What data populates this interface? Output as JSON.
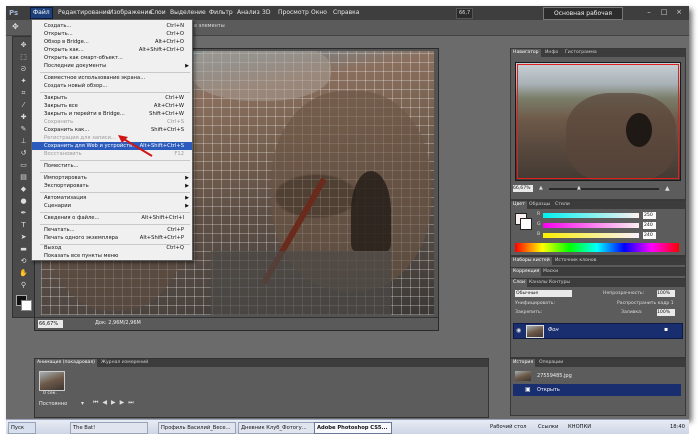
{
  "menubar": {
    "logo": "Ps",
    "items": [
      "Файл",
      "Редактирование",
      "Изображение",
      "Слои",
      "Выделение",
      "Фильтр",
      "Анализ",
      "3D",
      "Просмотр",
      "Окно",
      "Справка"
    ],
    "zoom": "66,7",
    "workspace_button": "Основная рабочая среда"
  },
  "options_bar": {
    "text": "е элементы"
  },
  "file_menu": {
    "items": [
      {
        "label": "Создать...",
        "shortcut": "Ctrl+N"
      },
      {
        "label": "Открыть...",
        "shortcut": "Ctrl+O"
      },
      {
        "label": "Обзор в Bridge...",
        "shortcut": "Alt+Ctrl+O"
      },
      {
        "label": "Открыть как...",
        "shortcut": "Alt+Shift+Ctrl+O"
      },
      {
        "label": "Открыть как смарт-объект...",
        "shortcut": ""
      },
      {
        "label": "Последние документы",
        "shortcut": ""
      },
      {
        "label": "Совместное использование экрана...",
        "shortcut": ""
      },
      {
        "label": "Создать новый обзор...",
        "shortcut": ""
      },
      {
        "label": "Закрыть",
        "shortcut": "Ctrl+W"
      },
      {
        "label": "Закрыть все",
        "shortcut": "Alt+Ctrl+W"
      },
      {
        "label": "Закрыть и перейти в Bridge...",
        "shortcut": "Shift+Ctrl+W"
      },
      {
        "label": "Сохранить",
        "shortcut": "Ctrl+S"
      },
      {
        "label": "Сохранить как...",
        "shortcut": "Shift+Ctrl+S"
      },
      {
        "label": "Регистрация для записи...",
        "shortcut": ""
      },
      {
        "label": "Сохранить для Web и устройств...",
        "shortcut": "Alt+Shift+Ctrl+S"
      },
      {
        "label": "Восстановить",
        "shortcut": "F12"
      },
      {
        "label": "Поместить...",
        "shortcut": ""
      },
      {
        "label": "Импортировать",
        "shortcut": ""
      },
      {
        "label": "Экспортировать",
        "shortcut": ""
      },
      {
        "label": "Автоматизация",
        "shortcut": ""
      },
      {
        "label": "Сценарии",
        "shortcut": ""
      },
      {
        "label": "Сведения о файле...",
        "shortcut": "Alt+Shift+Ctrl+I"
      },
      {
        "label": "Печатать...",
        "shortcut": "Ctrl+P"
      },
      {
        "label": "Печать одного экземпляра",
        "shortcut": "Alt+Shift+Ctrl+P"
      },
      {
        "label": "Выход",
        "shortcut": "Ctrl+Q"
      },
      {
        "label": "Показать все пункты меню",
        "shortcut": ""
      }
    ]
  },
  "document": {
    "zoom": "66,67%",
    "info": "Док: 2,96M/2,96M"
  },
  "navigator": {
    "tabs": [
      "Навигатор",
      "Инфо",
      "Гистограмма"
    ],
    "zoom": "66,67%"
  },
  "color_panel": {
    "tabs": [
      "Цвет",
      "Образцы",
      "Стили"
    ],
    "channels": [
      {
        "label": "R",
        "value": "250"
      },
      {
        "label": "G",
        "value": "240"
      },
      {
        "label": "B",
        "value": "240"
      }
    ]
  },
  "adjust_panel": {
    "tabs": [
      "Наборы кистей",
      "Источник клонов"
    ]
  },
  "correction_panel": {
    "tabs": [
      "Коррекция",
      "Маски"
    ]
  },
  "layers_panel": {
    "tabs": [
      "Слои",
      "Каналы",
      "Контуры"
    ],
    "blend_mode": "Обычные",
    "opacity_label": "Непрозрачность:",
    "opacity_value": "100%",
    "lock_label": "Закрепить:",
    "fill_label": "Заливка:",
    "fill_value": "100%",
    "propagate_label": "Распространить кадр 1",
    "unify_label": "Унифицировать:",
    "layer_name": "Фон"
  },
  "history_panel": {
    "tabs": [
      "История",
      "Операции"
    ],
    "file": "27559485.jpg",
    "step": "Открыть"
  },
  "animation_panel": {
    "tabs": [
      "Анимация (покадровая)",
      "Журнал измерений"
    ],
    "frame_time": "0 сек.",
    "loop": "Постоянно"
  },
  "taskbar": {
    "start": "Пуск",
    "items": [
      "The Bat!",
      "Профиль Василий_Весе...",
      "Дневник Клуб_Фотогу...",
      "Adobe Photoshop CS5..."
    ],
    "tray": [
      "Рабочий стол",
      "Ссылки",
      "КНОПКИ"
    ],
    "clock": "18:40"
  }
}
